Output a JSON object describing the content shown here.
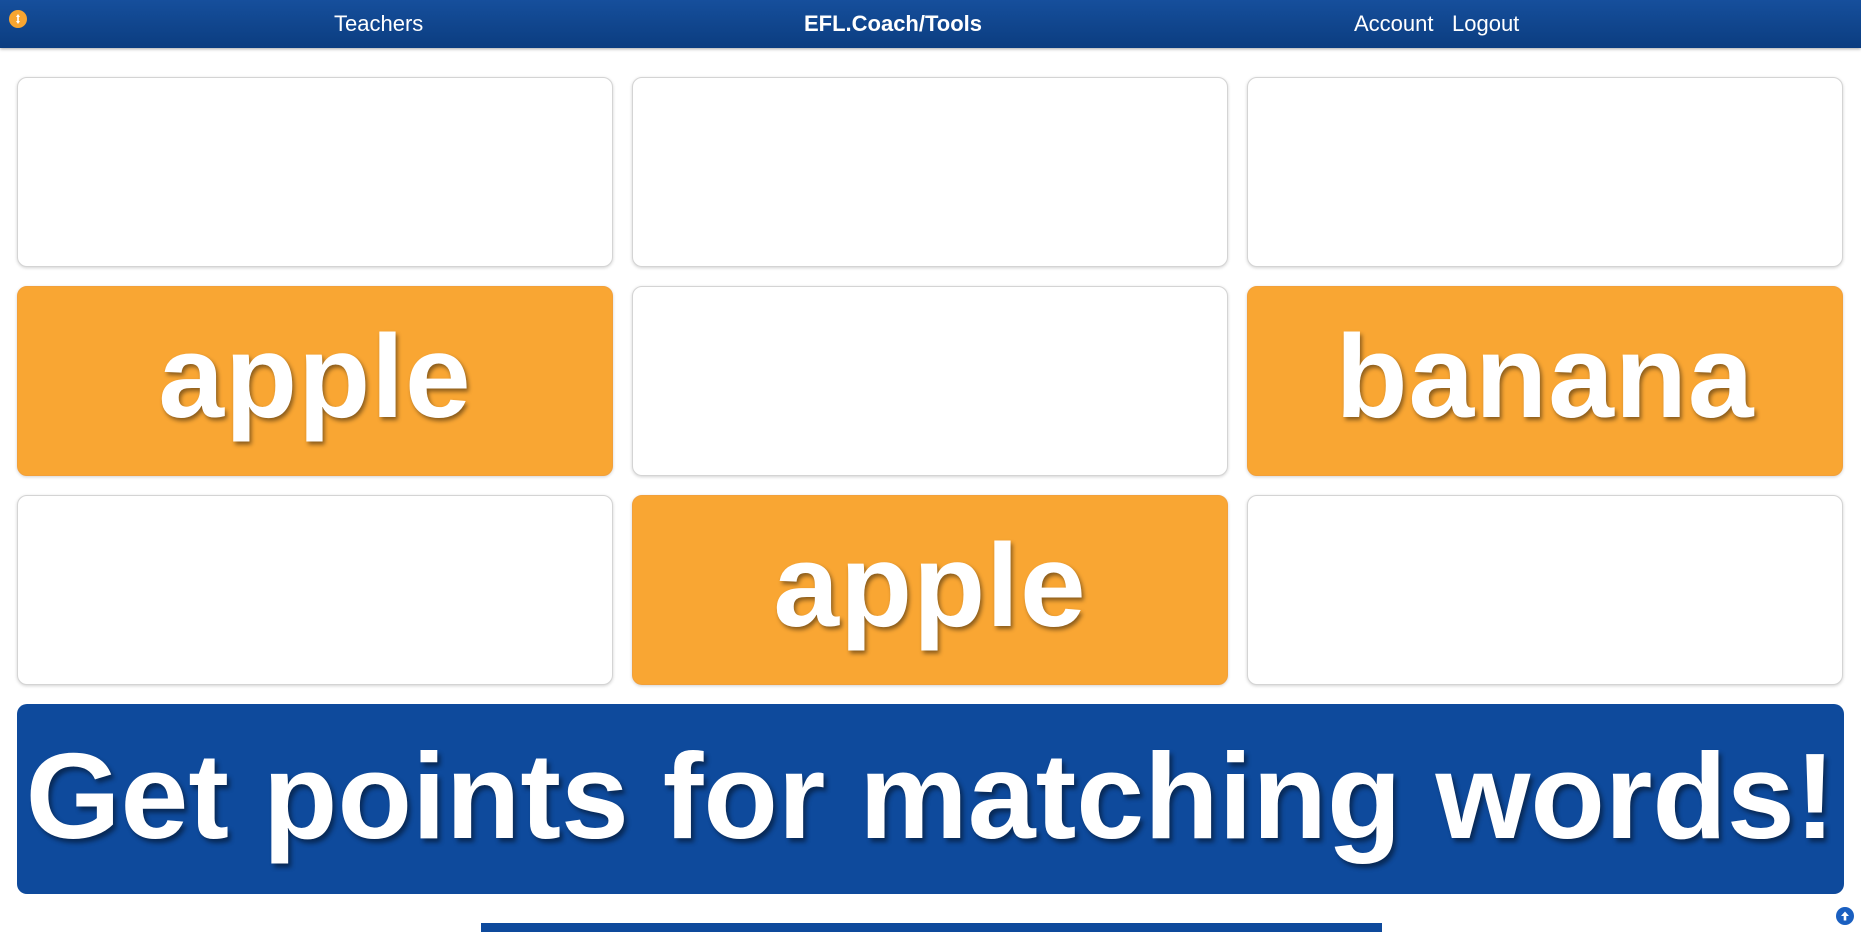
{
  "nav": {
    "menu_icon": "gear-icon",
    "teachers": "Teachers",
    "brand": "EFL.Coach/Tools",
    "account": "Account",
    "logout": "Logout"
  },
  "grid": {
    "cards": [
      {
        "word": "",
        "revealed": false
      },
      {
        "word": "",
        "revealed": false
      },
      {
        "word": "",
        "revealed": false
      },
      {
        "word": "apple",
        "revealed": true
      },
      {
        "word": "",
        "revealed": false
      },
      {
        "word": "banana",
        "revealed": true
      },
      {
        "word": "",
        "revealed": false
      },
      {
        "word": "apple",
        "revealed": true
      },
      {
        "word": "",
        "revealed": false
      }
    ]
  },
  "banner": {
    "text": "Get points for matching words!"
  },
  "colors": {
    "nav_bg": "#0e4a9c",
    "card_revealed": "#f9a633",
    "banner_bg": "#0e4a9c"
  },
  "icons": {
    "scroll_top": "arrow-up-circle-icon"
  }
}
